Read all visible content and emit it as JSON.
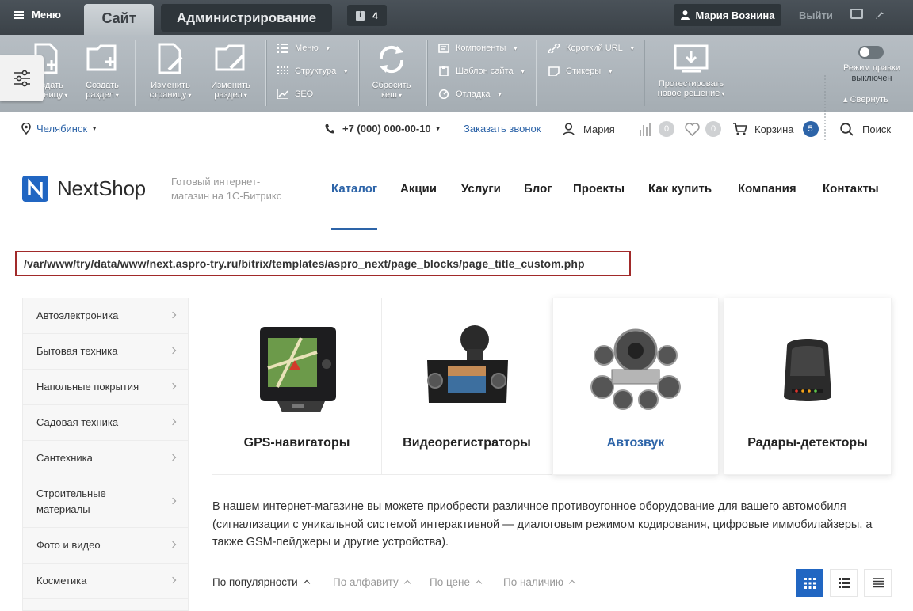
{
  "admin": {
    "menu_label": "Меню",
    "tab_site": "Сайт",
    "tab_admin": "Администрирование",
    "notifications_count": "4",
    "user_name": "Мария Вознина",
    "logout": "Выйти",
    "toolbar": {
      "create_page_1": "Создать",
      "create_page_2": "страницу",
      "create_section_1": "Создать",
      "create_section_2": "раздел",
      "edit_page_1": "Изменить",
      "edit_page_2": "страницу",
      "edit_section_1": "Изменить",
      "edit_section_2": "раздел",
      "menu": "Меню",
      "structure": "Структура",
      "seo": "SEO",
      "reset_cache_1": "Сбросить",
      "reset_cache_2": "кеш",
      "components": "Компоненты",
      "site_template": "Шаблон сайта",
      "debug": "Отладка",
      "short_url": "Короткий URL",
      "stickers": "Стикеры",
      "test_solution_1": "Протестировать",
      "test_solution_2": "новое решение",
      "edit_mode_1": "Режим правки",
      "edit_mode_2": "выключен",
      "collapse": "Свернуть"
    }
  },
  "header": {
    "city": "Челябинск",
    "phone": "+7 (000) 000-00-10",
    "callback": "Заказать звонок",
    "user": "Мария",
    "compare_count": "0",
    "favorites_count": "0",
    "cart_label": "Корзина",
    "cart_count": "5",
    "search_label": "Поиск"
  },
  "brand": {
    "logo_text": "NextShop",
    "slogan": "Готовый интернет-магазин на 1С-Битрикс",
    "accent": "#2d64a8"
  },
  "nav": [
    "Каталог",
    "Акции",
    "Услуги",
    "Блог",
    "Проекты",
    "Как купить",
    "Компания",
    "Контакты"
  ],
  "page_path": "/var/www/try/data/www/next.aspro-try.ru/bitrix/templates/aspro_next/page_blocks/page_title_custom.php",
  "sidebar": [
    "Автоэлектроника",
    "Бытовая техника",
    "Напольные покрытия",
    "Садовая техника",
    "Сантехника",
    "Строительные материалы",
    "Фото и видео",
    "Косметика"
  ],
  "categories": [
    "GPS-навигаторы",
    "Видеорегистраторы",
    "Автозвук",
    "Радары-детекторы"
  ],
  "description": "В нашем интернет-магазине вы можете приобрести различное противоугонное оборудование для вашего автомобиля (сигнализации с уникальной системой интерактивной — диалоговым режимом кодирования, цифровые иммобилайзеры, а также GSM-пейджеры и другие устройства).",
  "sort": [
    "По популярности",
    "По алфавиту",
    "По цене",
    "По наличию"
  ]
}
